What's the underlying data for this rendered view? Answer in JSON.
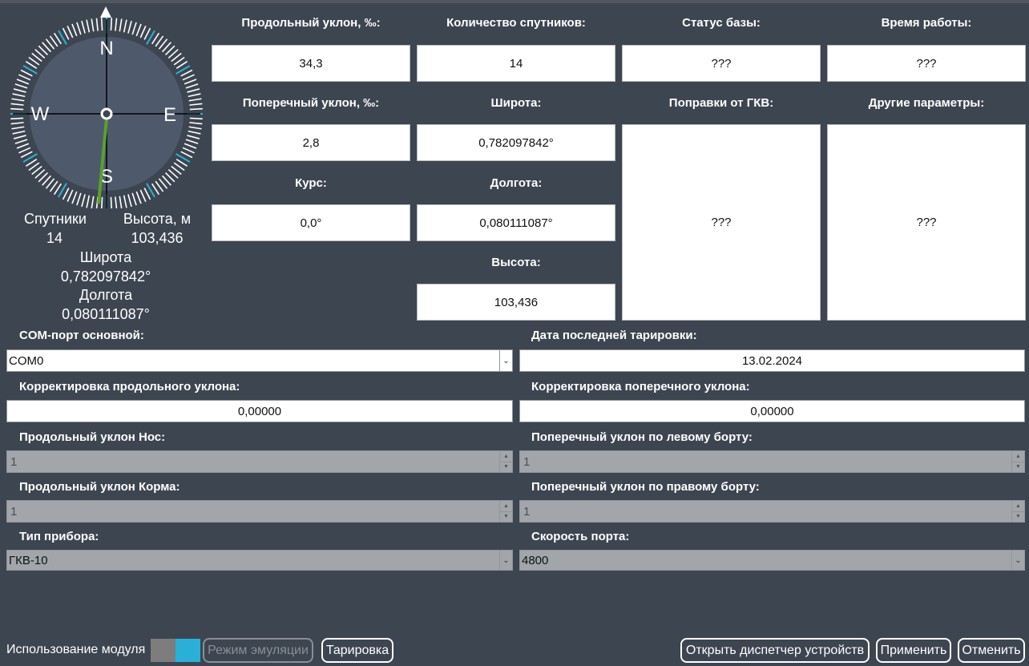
{
  "compass": {
    "north": "N",
    "south": "S",
    "east": "E",
    "west": "W",
    "heading_deg": 0.0
  },
  "compass_info": {
    "satellites_label": "Спутники",
    "satellites_value": "14",
    "height_label": "Высота, м",
    "height_value": "103,436",
    "lat_label": "Широта",
    "lat_value": "0,782097842°",
    "lon_label": "Долгота",
    "lon_value": "0,080111087°"
  },
  "fields": {
    "long_slope_label": "Продольный уклон, ‰:",
    "long_slope_value": "34,3",
    "sat_count_label": "Количество спутников:",
    "sat_count_value": "14",
    "base_status_label": "Статус базы:",
    "base_status_value": "???",
    "uptime_label": "Время работы:",
    "uptime_value": "???",
    "cross_slope_label": "Поперечный уклон, ‰:",
    "cross_slope_value": "2,8",
    "lat_label": "Широта:",
    "lat_value": "0,782097842°",
    "corrections_label": "Поправки от ГКВ:",
    "corrections_value": "???",
    "other_label": "Другие параметры:",
    "other_value": "???",
    "course_label": "Курс:",
    "course_value": "0,0°",
    "lon_label": "Долгота:",
    "lon_value": "0,080111087°",
    "height_label": "Высота:",
    "height_value": "103,436"
  },
  "form": {
    "com_port_label": "COM-порт основной:",
    "com_port_value": "COM0",
    "calib_date_label": "Дата последней тарировки:",
    "calib_date_value": "13.02.2024",
    "long_corr_label": "Корректировка продольного уклона:",
    "long_corr_value": "0,00000",
    "cross_corr_label": "Корректировка поперечного уклона:",
    "cross_corr_value": "0,00000",
    "long_nose_label": "Продольный уклон Нос:",
    "long_nose_value": "1",
    "cross_left_label": "Поперечный уклон по левому борту:",
    "cross_left_value": "1",
    "long_stern_label": "Продольный уклон Корма:",
    "long_stern_value": "1",
    "cross_right_label": "Поперечный уклон по правому борту:",
    "cross_right_value": "1",
    "device_type_label": "Тип прибора:",
    "device_type_value": "ГКВ-10",
    "port_speed_label": "Скорость порта:",
    "port_speed_value": "4800"
  },
  "bottom": {
    "module_use_label": "Использование модуля",
    "emulation_label": "Режим эмуляции",
    "calibration_label": "Тарировка",
    "device_manager_label": "Открыть диспетчер устройств",
    "apply_label": "Применить",
    "cancel_label": "Отменить"
  },
  "colors": {
    "background": "#3d4550",
    "compass_face": "#4e5a6c",
    "toggle_on": "#2ab0d8",
    "needle": "#5aa02c"
  }
}
